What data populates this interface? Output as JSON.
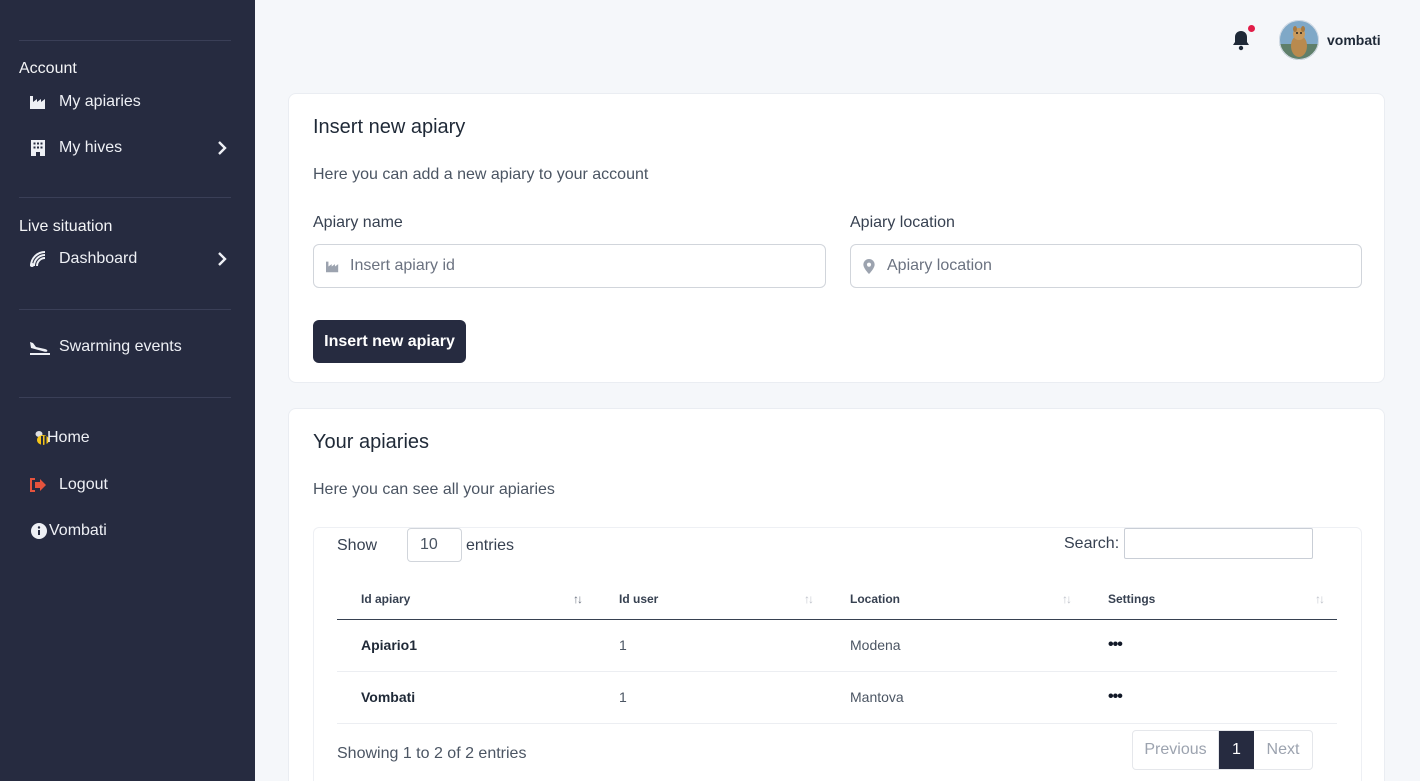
{
  "sidebar": {
    "sections": [
      {
        "title": "Account"
      },
      {
        "title": "Live situation"
      }
    ],
    "items": [
      {
        "label": "My apiaries",
        "icon": "factory-icon"
      },
      {
        "label": "My hives",
        "icon": "building-icon"
      },
      {
        "label": "Dashboard",
        "icon": "satellite-dish-icon"
      },
      {
        "label": "Swarming events",
        "icon": "plane-landing-icon"
      },
      {
        "label": "Home",
        "icon": "bee-icon"
      },
      {
        "label": "Logout",
        "icon": "sign-out-icon"
      },
      {
        "label": "Vombati",
        "icon": "info-circle-icon"
      }
    ]
  },
  "topbar": {
    "username": "vombati",
    "notification_dot_color": "#e11d48"
  },
  "insert_card": {
    "title": "Insert new apiary",
    "subtitle": "Here you can add a new apiary to your account",
    "name_label": "Apiary name",
    "name_placeholder": "Insert apiary id",
    "location_label": "Apiary location",
    "location_placeholder": "Apiary location",
    "submit_label": "Insert new apiary"
  },
  "apiaries_card": {
    "title": "Your apiaries",
    "subtitle": "Here you can see all your apiaries",
    "show_label": "Show",
    "page_length": "10",
    "entries_label": "entries",
    "search_label": "Search:",
    "columns": [
      "Id apiary",
      "Id user",
      "Location",
      "Settings"
    ],
    "rows": [
      {
        "id_apiary": "Apiario1",
        "id_user": "1",
        "location": "Modena",
        "settings": "•••"
      },
      {
        "id_apiary": "Vombati",
        "id_user": "1",
        "location": "Mantova",
        "settings": "•••"
      }
    ],
    "info": "Showing 1 to 2 of 2 entries",
    "pager": {
      "previous": "Previous",
      "current": "1",
      "next": "Next"
    }
  },
  "colors": {
    "sidebar_bg": "#262b40",
    "button_dark": "#262b40",
    "logout_icon": "#e5533d",
    "home_icon": "#f5c518"
  }
}
